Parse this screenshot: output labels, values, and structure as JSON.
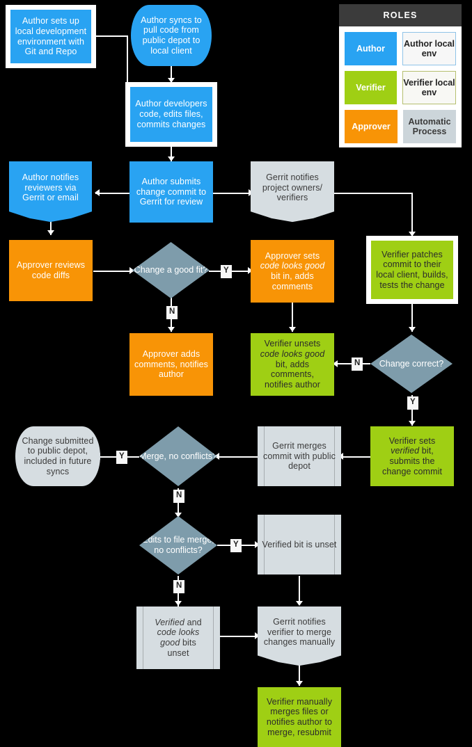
{
  "legend": {
    "title": "ROLES",
    "rows": [
      {
        "fill": "Author",
        "env": "Author local env"
      },
      {
        "fill": "Verifier",
        "env": "Verifier local env"
      },
      {
        "fill": "Approver",
        "env": "Automatic Process"
      }
    ]
  },
  "nodes": {
    "setup": "Author sets up local development environment with Git and Repo",
    "sync": "Author syncs to pull code from public depot to local client",
    "develop": "Author developers code, edits files, commits changes",
    "notify_reviewers": "Author notifies reviewers via Gerrit or email",
    "submit_change": "Author submits change commit to Gerrit for review",
    "gerrit_notifies": "Gerrit notifies project owners/ verifiers",
    "approver_reviews": "Approver reviews code diffs",
    "good_fit": "Change a good fit?",
    "approver_sets": "Approver sets code looks good bit in, adds comments",
    "verifier_patches": "Verifier patches commit to their local client, builds, tests the change",
    "approver_adds": "Approver adds comments, notifies author",
    "verifier_unsets": "Verifier unsets code looks good bit, adds comments, notifies author",
    "change_correct": "Change correct?",
    "change_submitted": "Change submitted to public depot, included in future syncs",
    "merge_no_conf": "Merge, no conflicts?",
    "gerrit_merges": "Gerrit merges commit with public depot",
    "verifier_sets": "Verifier sets verified bit, submits the change commit",
    "edits_file_merge": "Edits to file merge, no conflicts?",
    "verified_unset": "Verified bit is unset",
    "bits_unset": "Verified and code looks good bits unset",
    "gerrit_notifies_verifier": "Gerrit notifies verifier to merge changes manually",
    "verifier_manual": "Verifier manually merges files or notifies author to merge, resubmit"
  },
  "edge_labels": {
    "good_fit_yes": "Y",
    "good_fit_no": "N",
    "change_correct_no": "N",
    "change_correct_yes": "Y",
    "merge_yes": "Y",
    "merge_no": "N",
    "edits_yes": "Y",
    "edits_no": "N"
  },
  "colors": {
    "author": "#29a3f2",
    "verifier": "#9fcf14",
    "approver": "#f89406",
    "automatic": "#d6dde1",
    "decision": "#7e9cab",
    "background": "#000000",
    "legend_header": "#3b3b3b"
  }
}
